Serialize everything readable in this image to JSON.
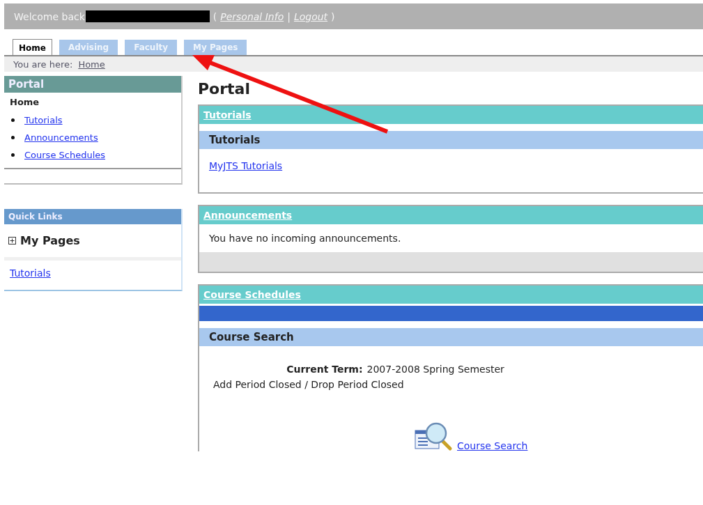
{
  "header": {
    "welcome": "Welcome back",
    "links": [
      {
        "label": "Personal Info"
      },
      {
        "label": "Logout"
      }
    ],
    "open": "(",
    "separator": "|",
    "close": ")"
  },
  "tabs": [
    {
      "label": "Home",
      "selected": true
    },
    {
      "label": "Advising",
      "selected": false
    },
    {
      "label": "Faculty",
      "selected": false
    },
    {
      "label": "My Pages",
      "selected": false
    }
  ],
  "breadcrumb": {
    "label": "You are here:",
    "current": "Home"
  },
  "sidebar": {
    "portal": {
      "title": "Portal",
      "heading": "Home",
      "items": [
        {
          "label": "Tutorials"
        },
        {
          "label": "Announcements"
        },
        {
          "label": "Course Schedules"
        }
      ]
    },
    "quick_links": {
      "title": "Quick Links",
      "group": {
        "label": "My Pages",
        "expanded": false
      },
      "links": [
        {
          "label": "Tutorials"
        }
      ]
    }
  },
  "main": {
    "title": "Portal",
    "tutorials": {
      "title": "Tutorials",
      "subtitle": "Tutorials",
      "link": "MyJTS Tutorials"
    },
    "announcements": {
      "title": "Announcements",
      "message": "You have no incoming announcements."
    },
    "course_schedules": {
      "title": "Course Schedules",
      "subtitle": "Course Search",
      "term_label": "Current Term:",
      "term": "2007-2008 Spring Semester",
      "status": "Add Period Closed / Drop Period Closed",
      "search_link": "Course Search"
    }
  }
}
